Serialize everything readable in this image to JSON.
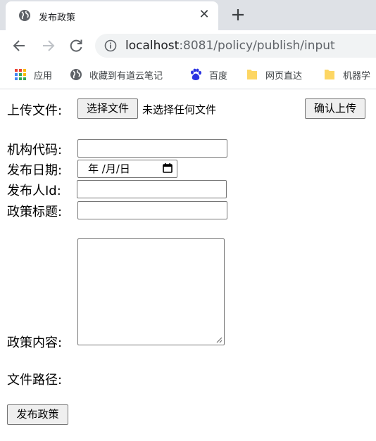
{
  "browser": {
    "tab": {
      "title": "发布政策",
      "favicon": "globe-icon",
      "close_glyph": "✕"
    },
    "new_tab_icon": "plus-icon",
    "nav": {
      "back_icon": "arrow-left-icon",
      "forward_icon": "arrow-right-icon",
      "reload_icon": "reload-icon"
    },
    "address_bar": {
      "security_icon": "info-icon",
      "host": "localhost",
      "rest": ":8081/policy/publish/input"
    },
    "bookmarks": [
      {
        "label": "应用",
        "icon": "apps-grid-icon"
      },
      {
        "label": "收藏到有道云笔记",
        "icon": "globe-icon"
      },
      {
        "label": "百度",
        "icon": "baidu-paw-icon"
      },
      {
        "label": "网页直达",
        "icon": "folder-icon"
      },
      {
        "label": "机器学",
        "icon": "folder-icon"
      }
    ]
  },
  "form": {
    "upload": {
      "label": "上传文件:",
      "choose_button": "选择文件",
      "status": "未选择任何文件",
      "confirm_button": "确认上传"
    },
    "org_code": {
      "label": "机构代码:",
      "value": ""
    },
    "publish_date": {
      "label": "发布日期:",
      "placeholder": "年 /月/日"
    },
    "publisher_id": {
      "label": "发布人Id:",
      "value": ""
    },
    "title": {
      "label": "政策标题:",
      "value": ""
    },
    "content": {
      "label": "政策内容:",
      "value": ""
    },
    "file_path": {
      "label": "文件路径:",
      "value": ""
    },
    "submit_button": "发布政策"
  },
  "colors": {
    "tabstrip_bg": "#dee1e6",
    "omnibox_bg": "#f1f3f4",
    "button_bg": "#efefef",
    "input_border": "#767676",
    "folder_yellow": "#fdd663"
  }
}
